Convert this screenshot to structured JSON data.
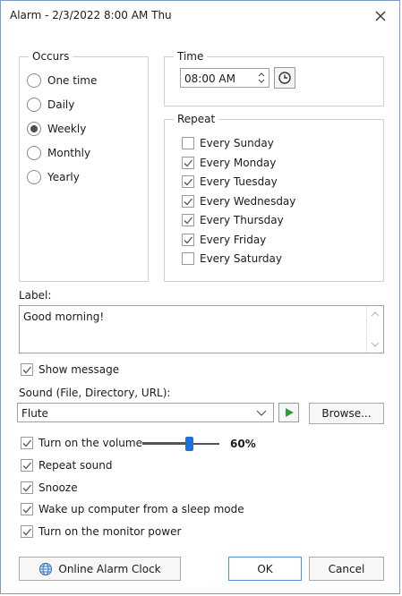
{
  "window": {
    "title": "Alarm - 2/3/2022 8:00 AM Thu"
  },
  "occurs": {
    "legend": "Occurs",
    "options": [
      {
        "label": "One time",
        "selected": false
      },
      {
        "label": "Daily",
        "selected": false
      },
      {
        "label": "Weekly",
        "selected": true
      },
      {
        "label": "Monthly",
        "selected": false
      },
      {
        "label": "Yearly",
        "selected": false
      }
    ]
  },
  "time": {
    "legend": "Time",
    "value": "08:00 AM",
    "clock_icon": "clock-icon"
  },
  "repeat": {
    "legend": "Repeat",
    "days": [
      {
        "label": "Every Sunday",
        "checked": false
      },
      {
        "label": "Every Monday",
        "checked": true
      },
      {
        "label": "Every Tuesday",
        "checked": true
      },
      {
        "label": "Every Wednesday",
        "checked": true
      },
      {
        "label": "Every Thursday",
        "checked": true
      },
      {
        "label": "Every Friday",
        "checked": true
      },
      {
        "label": "Every Saturday",
        "checked": false
      }
    ]
  },
  "label_section": {
    "heading": "Label:",
    "value": "Good morning!"
  },
  "show_message": {
    "label": "Show message",
    "checked": true
  },
  "sound": {
    "heading": "Sound (File, Directory, URL):",
    "value": "Flute",
    "browse_label": "Browse..."
  },
  "options": [
    {
      "label": "Turn on the volume",
      "checked": true
    },
    {
      "label": "Repeat sound",
      "checked": true
    },
    {
      "label": "Snooze",
      "checked": true
    },
    {
      "label": "Wake up computer from a sleep mode",
      "checked": true
    },
    {
      "label": "Turn on the monitor power",
      "checked": true
    }
  ],
  "volume": {
    "percent": 60,
    "display": "60%"
  },
  "buttons": {
    "online": "Online Alarm Clock",
    "ok": "OK",
    "cancel": "Cancel"
  },
  "colors": {
    "accent": "#1e6fd9",
    "play": "#2e9e3e",
    "ok_border": "#4a90d9"
  }
}
